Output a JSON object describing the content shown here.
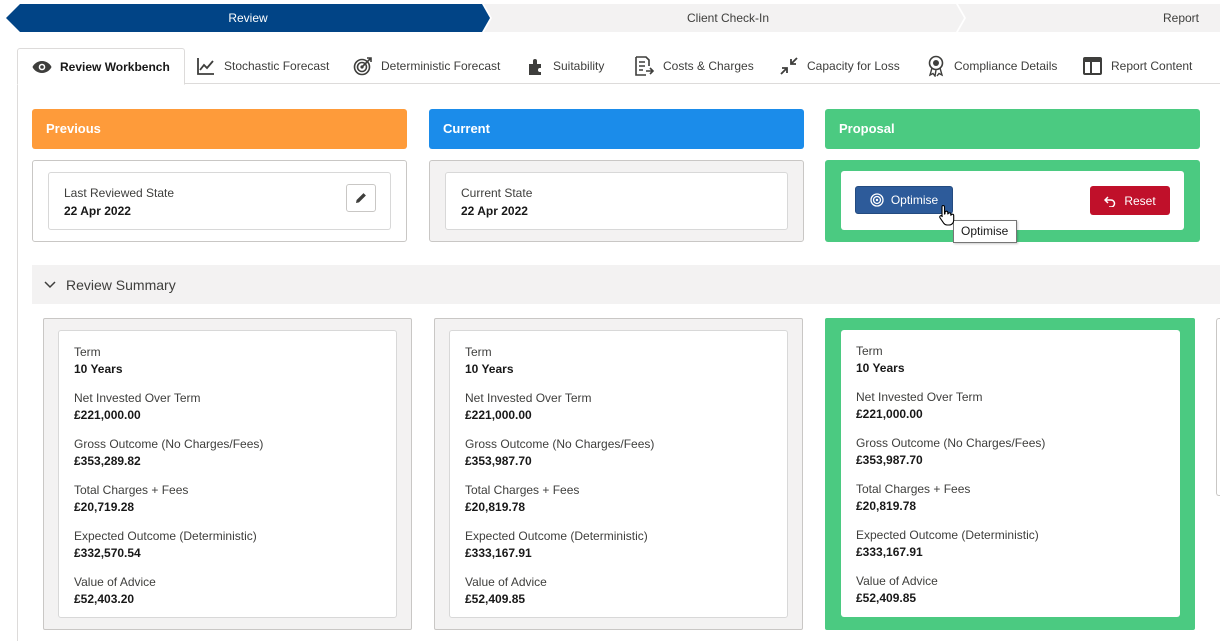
{
  "path": {
    "stages": [
      {
        "label": "Review",
        "active": true
      },
      {
        "label": "Client Check-In",
        "active": false
      },
      {
        "label": "Report",
        "active": false
      }
    ]
  },
  "tabs": [
    {
      "label": "Review Workbench",
      "icon": "eye-icon",
      "active": true
    },
    {
      "label": "Stochastic Forecast",
      "icon": "line-chart-icon",
      "active": false
    },
    {
      "label": "Deterministic Forecast",
      "icon": "target-arrow-icon",
      "active": false
    },
    {
      "label": "Suitability",
      "icon": "puzzle-icon",
      "active": false
    },
    {
      "label": "Costs & Charges",
      "icon": "document-arrow-icon",
      "active": false
    },
    {
      "label": "Capacity for Loss",
      "icon": "contract-arrows-icon",
      "active": false
    },
    {
      "label": "Compliance Details",
      "icon": "award-icon",
      "active": false
    },
    {
      "label": "Report Content",
      "icon": "layout-icon",
      "active": false
    }
  ],
  "columns": {
    "previous": {
      "title": "Previous",
      "state_label": "Last Reviewed State",
      "state_value": "22 Apr 2022"
    },
    "current": {
      "title": "Current",
      "state_label": "Current State",
      "state_value": "22 Apr 2022"
    },
    "proposal": {
      "title": "Proposal",
      "optimise_label": "Optimise",
      "reset_label": "Reset",
      "tooltip": "Optimise"
    }
  },
  "summary": {
    "title": "Review Summary",
    "cards": [
      {
        "metrics": [
          {
            "label": "Term",
            "value": "10 Years"
          },
          {
            "label": "Net Invested Over Term",
            "value": "£221,000.00"
          },
          {
            "label": "Gross Outcome (No Charges/Fees)",
            "value": "£353,289.82"
          },
          {
            "label": "Total Charges + Fees",
            "value": "£20,719.28"
          },
          {
            "label": "Expected Outcome (Deterministic)",
            "value": "£332,570.54"
          },
          {
            "label": "Value of Advice",
            "value": "£52,403.20"
          }
        ]
      },
      {
        "metrics": [
          {
            "label": "Term",
            "value": "10 Years"
          },
          {
            "label": "Net Invested Over Term",
            "value": "£221,000.00"
          },
          {
            "label": "Gross Outcome (No Charges/Fees)",
            "value": "£353,987.70"
          },
          {
            "label": "Total Charges + Fees",
            "value": "£20,819.78"
          },
          {
            "label": "Expected Outcome (Deterministic)",
            "value": "£333,167.91"
          },
          {
            "label": "Value of Advice",
            "value": "£52,409.85"
          }
        ]
      },
      {
        "metrics": [
          {
            "label": "Term",
            "value": "10 Years"
          },
          {
            "label": "Net Invested Over Term",
            "value": "£221,000.00"
          },
          {
            "label": "Gross Outcome (No Charges/Fees)",
            "value": "£353,987.70"
          },
          {
            "label": "Total Charges + Fees",
            "value": "£20,819.78"
          },
          {
            "label": "Expected Outcome (Deterministic)",
            "value": "£333,167.91"
          },
          {
            "label": "Value of Advice",
            "value": "£52,409.85"
          }
        ]
      }
    ]
  },
  "colors": {
    "path_active": "#014486",
    "path_idle": "#f3f2f2",
    "previous": "#fe9b3a",
    "current": "#1b8cea",
    "proposal": "#4bca81",
    "optimise": "#2d5b9a",
    "reset": "#c0102a"
  }
}
